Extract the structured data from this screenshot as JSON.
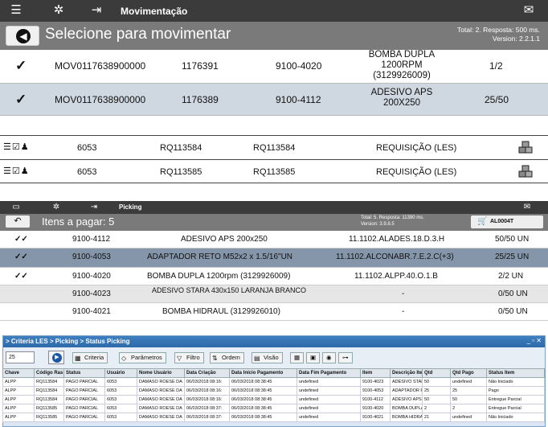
{
  "screen1": {
    "title": "Movimentação",
    "subtitle": "Selecione para movimentar",
    "info1": "Total: 2. Resposta: 500 ms.",
    "info2": "Version: 2.2.1.1",
    "rows": [
      {
        "code": "MOV0117638900000",
        "num": "1176391",
        "part": "9100-4020",
        "desc": "BOMBA DUPLA 1200RPM (3129926009)",
        "qty": "1/2"
      },
      {
        "code": "MOV0117638900000",
        "num": "1176389",
        "part": "9100-4112",
        "desc": "ADESIVO APS 200X250",
        "qty": "25/50"
      }
    ]
  },
  "reqs": [
    {
      "a": "6053",
      "b": "RQ113584",
      "c": "RQ113584",
      "d": "REQUISIÇÃO (LES)"
    },
    {
      "a": "6053",
      "b": "RQ113585",
      "c": "RQ113585",
      "d": "REQUISIÇÃO (LES)"
    }
  ],
  "screen2": {
    "title": "Picking",
    "subtitle": "Itens a pagar: 5",
    "info1": "Total: 5. Resposta: 11390 ms.",
    "info2": "Version: 3.9.8.5",
    "cart": "AL0004T",
    "rows": [
      {
        "part": "9100-4112",
        "desc": "ADESIVO APS 200x250",
        "loc": "11.1102.ALADES.18.D.3.H",
        "qty": "50/50 UN"
      },
      {
        "part": "9100-4053",
        "desc": "ADAPTADOR RETO M52x2 x 1.5/16\"UN",
        "loc": "11.1102.ALCONABR.7.E.2.C(+3)",
        "qty": "25/25 UN"
      },
      {
        "part": "9100-4020",
        "desc": "BOMBA DUPLA 1200rpm (3129926009)",
        "loc": "11.1102.ALPP.40.O.1.B",
        "qty": "2/2 UN"
      },
      {
        "part": "9100-4023",
        "desc": "ADESIVO STARA 430x150 LARANJA BRANCO",
        "loc": "-",
        "qty": "0/50 UN"
      },
      {
        "part": "9100-4021",
        "desc": "BOMBA HIDRAUL (3129926010)",
        "loc": "-",
        "qty": "0/50 UN"
      }
    ]
  },
  "screen3": {
    "title": "> Criteria LES > Picking > Status Picking",
    "page_size": "25",
    "buttons": {
      "criteria": "Criteria",
      "params": "Parâmetros",
      "filter": "Filtro",
      "order": "Ordem",
      "view": "Visão"
    },
    "headers": [
      "Chave",
      "Código Ras",
      "Status",
      "Usuário",
      "Nome Usuário",
      "Data Criação",
      "Data Início Pagamento",
      "Data Fim Pagamento",
      "Item",
      "Descrição Item",
      "Qtd",
      "Qtd Pago",
      "Status Item"
    ],
    "rows": [
      [
        "ALPP",
        "RQ113584",
        "PAGO PARCIAL",
        "6053",
        "DAMASO ROESE DA",
        "06/03/2018 08:16:",
        "06/03/2018 08:38:45",
        "undefined",
        "9100-4023",
        "ADESIVO STARA 430",
        "50",
        "undefined",
        "Não Iniciado"
      ],
      [
        "ALPP",
        "RQ113584",
        "PAGO PARCIAL",
        "6053",
        "DAMASO ROESE DA",
        "06/03/2018 08:16:",
        "06/03/2018 08:38:45",
        "undefined",
        "9100-4053",
        "ADAPTADOR RETO M",
        "25",
        "25",
        "Pago"
      ],
      [
        "ALPP",
        "RQ113584",
        "PAGO PARCIAL",
        "6053",
        "DAMASO ROESE DA",
        "06/03/2018 08:16:",
        "06/03/2018 08:38:45",
        "undefined",
        "9100-4112",
        "ADESIVO APS 200x2:",
        "50",
        "50",
        "Entregue Parcial"
      ],
      [
        "ALPP",
        "RQ113585",
        "PAGO PARCIAL",
        "6053",
        "DAMASO ROESE DA",
        "06/03/2018 08:37:",
        "06/03/2018 08:38:45",
        "undefined",
        "9100-4020",
        "BOMBA DUPLA 1200r",
        "2",
        "2",
        "Entregue Parcial"
      ],
      [
        "ALPP",
        "RQ113585",
        "PAGO PARCIAL",
        "6053",
        "DAMASO ROESE DA",
        "06/03/2018 08:37:",
        "06/03/2018 08:38:45",
        "undefined",
        "9100-4021",
        "BOMBA HIDRAUL (31",
        "21",
        "undefined",
        "Não Iniciado"
      ]
    ]
  }
}
